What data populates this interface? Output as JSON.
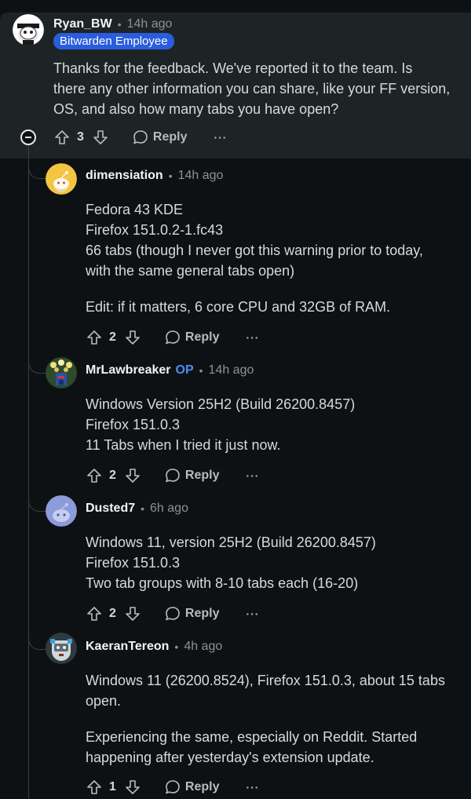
{
  "comments": [
    {
      "author": "Ryan_BW",
      "time": "14h ago",
      "flair": "Bitwarden Employee",
      "body": [
        "Thanks for the feedback. We've reported it to the team. Is",
        "there any other information you can share, like your FF version,",
        "OS, and also how many tabs you have open?"
      ],
      "score": "3",
      "reply": "Reply",
      "more": "···"
    },
    {
      "author": "dimensiation",
      "time": "14h ago",
      "body": [
        "Fedora 43 KDE",
        "Firefox 151.0.2-1.fc43",
        "66 tabs (though I never got this warning prior to today,",
        "with the same general tabs open)"
      ],
      "body2": [
        "Edit: if it matters, 6 core CPU and 32GB of RAM."
      ],
      "score": "2",
      "reply": "Reply",
      "more": "···"
    },
    {
      "author": "MrLawbreaker",
      "op": "OP",
      "time": "14h ago",
      "body": [
        "Windows Version 25H2 (Build 26200.8457)",
        "Firefox 151.0.3",
        "11 Tabs when I tried it just now."
      ],
      "score": "2",
      "reply": "Reply",
      "more": "···"
    },
    {
      "author": "Dusted7",
      "time": "6h ago",
      "body": [
        "Windows 11, version 25H2 (Build 26200.8457)",
        "Firefox 151.0.3",
        "Two tab groups with 8-10 tabs each (16-20)"
      ],
      "score": "2",
      "reply": "Reply",
      "more": "···"
    },
    {
      "author": "KaeranTereon",
      "time": "4h ago",
      "body": [
        "Windows 11 (26200.8524), Firefox 151.0.3, about 15 tabs",
        "open."
      ],
      "body2": [
        "Experiencing the same, especially on Reddit. Started",
        "happening after yesterday's extension update."
      ],
      "score": "1",
      "reply": "Reply",
      "more": "···"
    }
  ],
  "icons": {
    "upvote": "arrow-up-icon",
    "downvote": "arrow-down-icon",
    "reply": "speech-bubble-icon",
    "collapse": "minus-circle-icon"
  },
  "colors": {
    "background": "#0e1113",
    "highlight": "#1e2326",
    "flair": "#2a5ddd",
    "op": "#4f8cf7"
  }
}
